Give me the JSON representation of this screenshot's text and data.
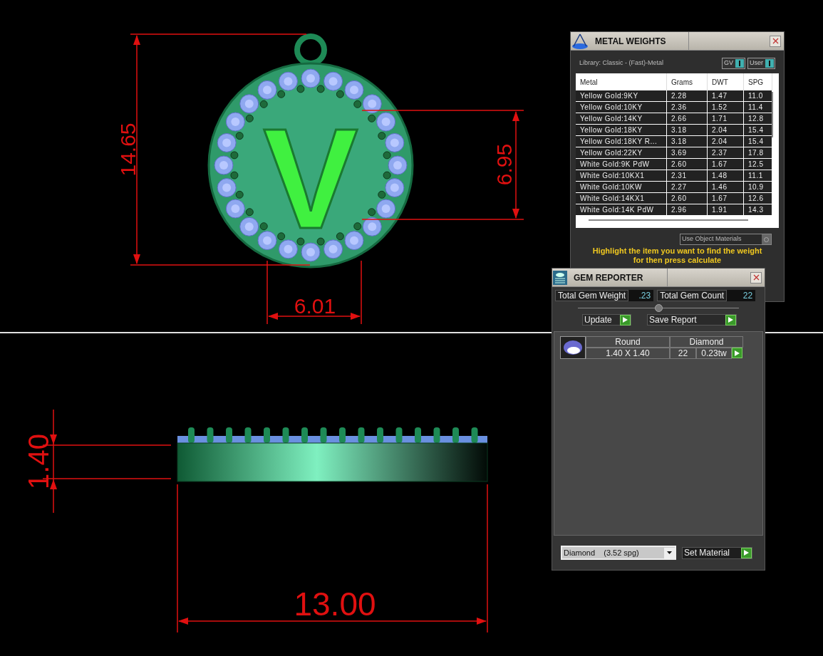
{
  "viewport": {
    "letter": "V",
    "top_dimensions": [
      "14.65",
      "6.95",
      "6.01"
    ],
    "side_dimensions": [
      "1.40",
      "13.00"
    ]
  },
  "metal_weights": {
    "title": "METAL WEIGHTS",
    "library": "Library: Classic - (Fast)-Metal",
    "toggles": [
      {
        "label": "GV",
        "on": true
      },
      {
        "label": "User",
        "on": true
      }
    ],
    "columns": [
      "Metal",
      "Grams",
      "DWT",
      "SPG"
    ],
    "rows": [
      [
        "Yellow Gold:9KY",
        "2.28",
        "1.47",
        "11.0"
      ],
      [
        "Yellow Gold:10KY",
        "2.36",
        "1.52",
        "11.4"
      ],
      [
        "Yellow Gold:14KY",
        "2.66",
        "1.71",
        "12.8"
      ],
      [
        "Yellow Gold:18KY",
        "3.18",
        "2.04",
        "15.4"
      ],
      [
        "Yellow Gold:18KY R...",
        "3.18",
        "2.04",
        "15.4"
      ],
      [
        "Yellow Gold:22KY",
        "3.69",
        "2.37",
        "17.8"
      ],
      [
        "White Gold:9K PdW",
        "2.60",
        "1.67",
        "12.5"
      ],
      [
        "White Gold:10KX1",
        "2.31",
        "1.48",
        "11.1"
      ],
      [
        "White Gold:10KW",
        "2.27",
        "1.46",
        "10.9"
      ],
      [
        "White Gold:14KX1",
        "2.60",
        "1.67",
        "12.6"
      ],
      [
        "White Gold:14K PdW",
        "2.96",
        "1.91",
        "14.3"
      ]
    ],
    "use_object_materials": {
      "label": "Use Object Materials",
      "checked": false
    },
    "hint": [
      "Highlight the item you want to find the weight",
      "for then press calculate"
    ]
  },
  "gem_reporter": {
    "title": "GEM REPORTER",
    "totals": [
      {
        "label": "Total Gem Weight",
        "value": ".23"
      },
      {
        "label": "Total Gem Count",
        "value": "22"
      }
    ],
    "buttons": [
      "Update",
      "Save Report"
    ],
    "gems": [
      {
        "shape": "Round",
        "material": "Diamond",
        "size": "1.40 X 1.40",
        "count": "22",
        "weight": "0.23tw"
      }
    ],
    "material_select": "Diamond    (3.52 spg)",
    "set_button": "Set Material"
  }
}
